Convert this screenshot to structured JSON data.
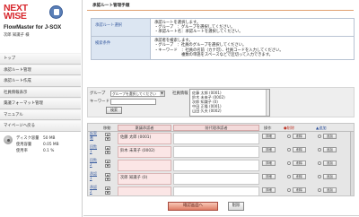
{
  "brand": {
    "logo_line1": "NEXT",
    "logo_line2": "WISE",
    "product": "FlowMaster for J-SOX",
    "user": "次郎 知識子 様"
  },
  "sidebar": {
    "items": [
      {
        "label": "トップ"
      },
      {
        "label": "承認ルート管理"
      },
      {
        "label": "承認ルート作成"
      },
      {
        "label": "社員情報表示"
      },
      {
        "label": "稟議フォーマット管理"
      },
      {
        "label": "マニュアル"
      },
      {
        "label": "マイページへ戻る"
      }
    ],
    "disk": {
      "capacity_label": "ディスク容量",
      "capacity_value": "50 MB",
      "used_label": "使用容量",
      "used_value": "0.05 MB",
      "rate_label": "使用率",
      "rate_value": "0.1 %"
    }
  },
  "main": {
    "title": "承認ルート管理手順",
    "info": [
      {
        "heading": "承認ルート選択",
        "lines": [
          "承認ルートを選択します。",
          "・グループ　：グループを選択してください。",
          "・承認ルート名：承認ルートを選択してください。"
        ]
      },
      {
        "heading": "検索条件",
        "lines": [
          "承認者を検索します。",
          "・グループ　：社員のグループを選択してください。",
          "・キーワード　：社員の名前（カナ可）、社員コードを入力してください。",
          "　　　　　　　複数の単語をスペースなどで区切って入力できます。"
        ]
      }
    ],
    "search": {
      "group_label": "グループ",
      "group_select": "グループを選択してください",
      "keyword_label": "キーワード",
      "search_button": "検索",
      "employee_label": "社員情報",
      "employees": [
        "佐藤 太郎 (0001)",
        "鈴木 未来子 (0002)",
        "次郎 知識子 (0)",
        "中田 正隆 (0001)",
        "山田 久夫 (0002)"
      ]
    },
    "grid": {
      "headers": {
        "order": "移動",
        "approver": "稟議承認者",
        "attention": "前代理承認者",
        "op": "操作",
        "delete": "●削除",
        "add": "▲追加"
      },
      "rows": [
        {
          "num": "起案者",
          "approver": "佐藤 太郎 (0001)",
          "op": "詳細",
          "delete": "削除",
          "add": "追加"
        },
        {
          "num": "回覧1",
          "approver": "鈴木 未来子 (0002)",
          "op": "詳細",
          "delete": "削除",
          "add": "追加"
        },
        {
          "num": "回覧2",
          "approver": "",
          "op": "詳細",
          "delete": "削除",
          "add": "追加"
        },
        {
          "num": "承認1",
          "approver": "次郎 知識子 (0)",
          "op": "詳細",
          "delete": "削除",
          "add": "追加"
        },
        {
          "num": "承認2",
          "approver": "",
          "op": "詳細",
          "delete": "削除",
          "add": "追加"
        }
      ]
    },
    "confirm_button": "確認画面へ",
    "delete_button": "削除"
  }
}
